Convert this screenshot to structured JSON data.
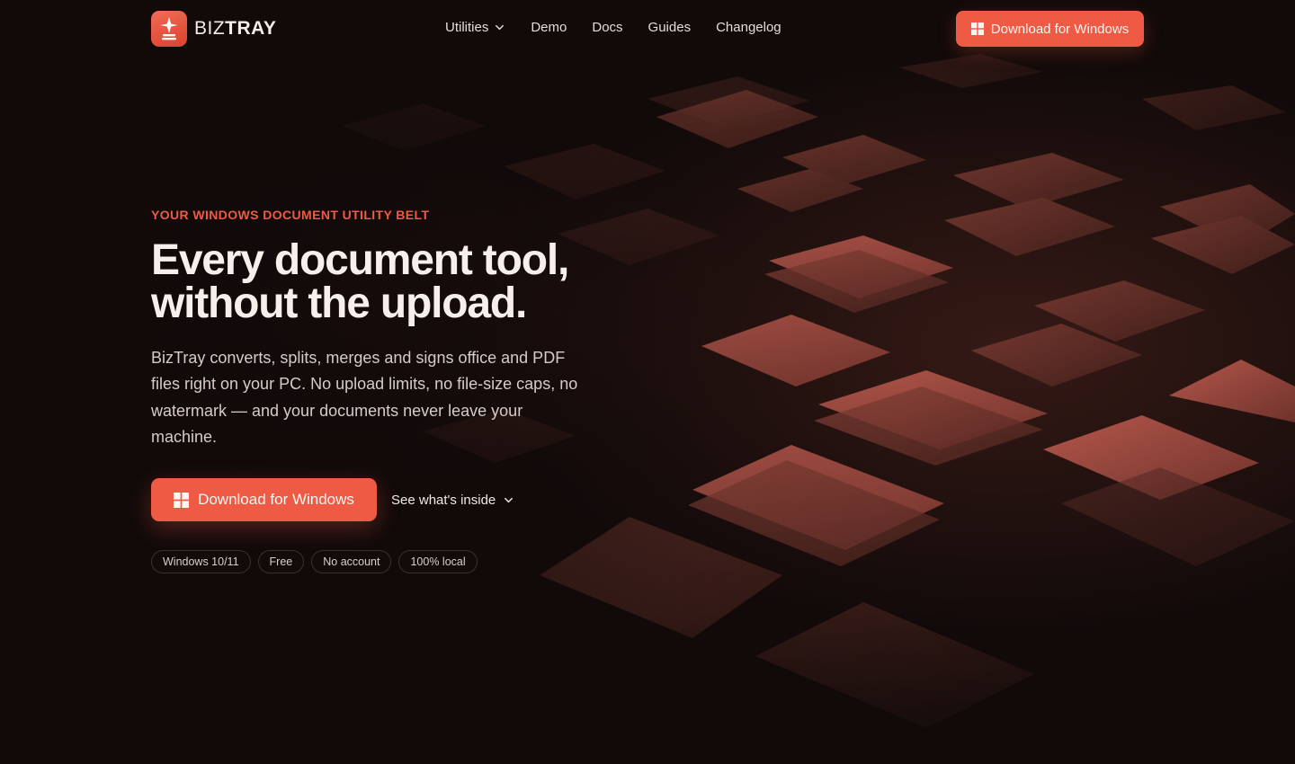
{
  "brand": {
    "name_light": "BIZ",
    "name_bold": "TRAY",
    "accent_color": "#ef5a44"
  },
  "nav": {
    "items": [
      {
        "label": "Utilities",
        "has_dropdown": true
      },
      {
        "label": "Demo"
      },
      {
        "label": "Docs"
      },
      {
        "label": "Guides"
      },
      {
        "label": "Changelog"
      }
    ],
    "cta_label": "Download for Windows",
    "cta_icon": "windows-icon"
  },
  "hero": {
    "eyebrow": "YOUR WINDOWS DOCUMENT UTILITY BELT",
    "title_line1": "Every document tool,",
    "title_line2": "without the upload.",
    "description": "BizTray converts, splits, merges and signs office and PDF files right on your PC. No upload limits, no file-size caps, no watermark — and your documents never leave your machine.",
    "primary_cta": "Download for Windows",
    "secondary_cta": "See what's inside",
    "tags": [
      "Windows 10/11",
      "Free",
      "No account",
      "100% local"
    ]
  }
}
